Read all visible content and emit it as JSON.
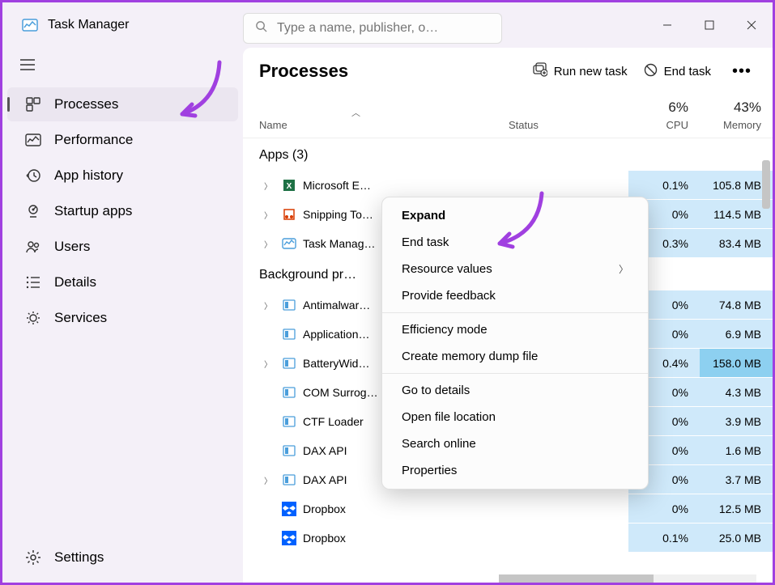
{
  "app": {
    "title": "Task Manager"
  },
  "search": {
    "placeholder": "Type a name, publisher, o…"
  },
  "sidebar": {
    "items": [
      {
        "label": "Processes",
        "icon": "processes"
      },
      {
        "label": "Performance",
        "icon": "performance"
      },
      {
        "label": "App history",
        "icon": "history"
      },
      {
        "label": "Startup apps",
        "icon": "startup"
      },
      {
        "label": "Users",
        "icon": "users"
      },
      {
        "label": "Details",
        "icon": "details"
      },
      {
        "label": "Services",
        "icon": "services"
      }
    ],
    "footer": {
      "label": "Settings",
      "icon": "settings"
    }
  },
  "main": {
    "title": "Processes",
    "actions": {
      "runNew": "Run new task",
      "endTask": "End task"
    },
    "columns": {
      "name": "Name",
      "status": "Status",
      "cpu": {
        "pct": "6%",
        "label": "CPU"
      },
      "mem": {
        "pct": "43%",
        "label": "Memory"
      }
    },
    "groups": [
      {
        "title": "Apps (3)",
        "rows": [
          {
            "name": "Microsoft E…",
            "cpu": "0.1%",
            "mem": "105.8 MB",
            "icon": "excel",
            "expandable": true
          },
          {
            "name": "Snipping To…",
            "cpu": "0%",
            "mem": "114.5 MB",
            "icon": "snip",
            "expandable": true
          },
          {
            "name": "Task Manag…",
            "cpu": "0.3%",
            "mem": "83.4 MB",
            "icon": "taskmgr",
            "expandable": true
          }
        ]
      },
      {
        "title": "Background pr…",
        "rows": [
          {
            "name": "Antimalwar…",
            "cpu": "0%",
            "mem": "74.8 MB",
            "icon": "generic",
            "expandable": true
          },
          {
            "name": "Application…",
            "cpu": "0%",
            "mem": "6.9 MB",
            "icon": "generic",
            "expandable": false
          },
          {
            "name": "BatteryWid…",
            "cpu": "0.4%",
            "mem": "158.0 MB",
            "icon": "generic",
            "expandable": true,
            "memHot": true
          },
          {
            "name": "COM Surrog…",
            "cpu": "0%",
            "mem": "4.3 MB",
            "icon": "generic",
            "expandable": false
          },
          {
            "name": "CTF Loader",
            "cpu": "0%",
            "mem": "3.9 MB",
            "icon": "generic",
            "expandable": false
          },
          {
            "name": "DAX API",
            "cpu": "0%",
            "mem": "1.6 MB",
            "icon": "generic",
            "expandable": false
          },
          {
            "name": "DAX API",
            "cpu": "0%",
            "mem": "3.7 MB",
            "icon": "generic",
            "expandable": true
          },
          {
            "name": "Dropbox",
            "cpu": "0%",
            "mem": "12.5 MB",
            "icon": "dropbox",
            "expandable": false
          },
          {
            "name": "Dropbox",
            "cpu": "0.1%",
            "mem": "25.0 MB",
            "icon": "dropbox",
            "expandable": false
          }
        ]
      }
    ]
  },
  "contextMenu": {
    "items": [
      {
        "label": "Expand",
        "bold": true
      },
      {
        "label": "End task"
      },
      {
        "label": "Resource values",
        "submenu": true
      },
      {
        "label": "Provide feedback"
      },
      {
        "sep": true
      },
      {
        "label": "Efficiency mode"
      },
      {
        "label": "Create memory dump file"
      },
      {
        "sep": true
      },
      {
        "label": "Go to details"
      },
      {
        "label": "Open file location"
      },
      {
        "label": "Search online"
      },
      {
        "label": "Properties"
      }
    ]
  }
}
